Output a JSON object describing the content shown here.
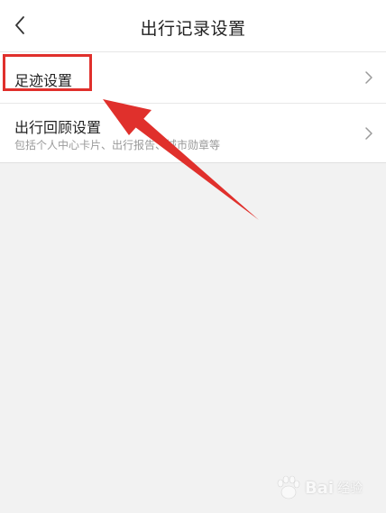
{
  "header": {
    "title": "出行记录设置",
    "back_icon": "chevron-left-icon"
  },
  "list": {
    "items": [
      {
        "title": "足迹设置",
        "subtitle": "",
        "icon": "chevron-right-icon"
      },
      {
        "title": "出行回顾设置",
        "subtitle": "包括个人中心卡片、出行报告、城市勋章等",
        "icon": "chevron-right-icon"
      }
    ]
  },
  "annotation": {
    "highlight_color": "#e0302c",
    "arrow_color": "#e0302c"
  },
  "watermark": {
    "brand": "Bai",
    "sub": "经验",
    "logo": "paw-logo"
  },
  "colors": {
    "background": "#f2f2f2",
    "surface": "#ffffff",
    "subtitle": "#9a9a9a"
  }
}
